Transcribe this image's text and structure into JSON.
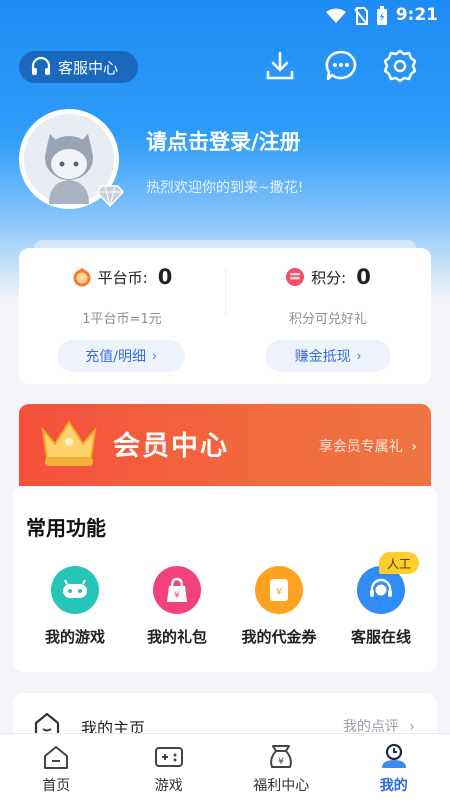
{
  "status_bar": {
    "time": "9:21"
  },
  "header": {
    "service_center": "客服中心",
    "icons": [
      "download-icon",
      "message-icon",
      "settings-icon"
    ]
  },
  "profile": {
    "login_prompt": "请点击登录/注册",
    "welcome": "热烈欢迎你的到来~撒花!"
  },
  "wallet": {
    "platform_coin_label": "平台币:",
    "platform_coin_value": "0",
    "platform_coin_note": "1平台币=1元",
    "platform_coin_button": "充值/明细",
    "points_label": "积分:",
    "points_value": "0",
    "points_note": "积分可兑好礼",
    "points_button": "赚金抵现"
  },
  "vip": {
    "title": "会员中心",
    "link": "享会员专属礼"
  },
  "features": {
    "title": "常用功能",
    "items": [
      {
        "label": "我的游戏",
        "color": "#27c4b8"
      },
      {
        "label": "我的礼包",
        "color": "#f2427a"
      },
      {
        "label": "我的代金券",
        "color": "#ffa21f"
      },
      {
        "label": "客服在线",
        "color": "#2f8df5"
      }
    ],
    "badge": "人工"
  },
  "homepage_row": {
    "label": "我的主页",
    "right": "我的点评"
  },
  "tabbar": {
    "tabs": [
      {
        "label": "首页"
      },
      {
        "label": "游戏"
      },
      {
        "label": "福利中心"
      },
      {
        "label": "我的"
      }
    ],
    "active": "我的"
  },
  "colors": {
    "accent": "#2f6ad9",
    "hero_blue": "#1e8cf5",
    "vip_red": "#f5503b"
  }
}
